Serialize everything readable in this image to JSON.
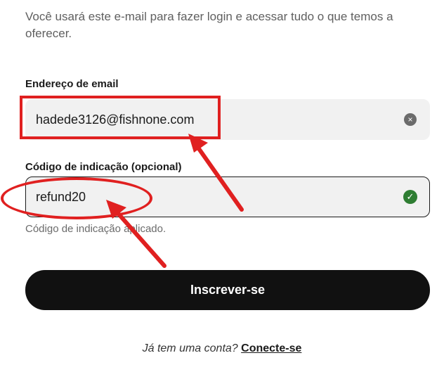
{
  "intro": {
    "text": "Você usará este e-mail para fazer login e acessar tudo o que temos a oferecer."
  },
  "email": {
    "label": "Endereço de email",
    "value": "hadede3126@fishnone.com",
    "clear_icon": "×"
  },
  "referral": {
    "label": "Código de indicação (opcional)",
    "value": "refund20",
    "status_icon": "✓",
    "helper": "Código de indicação aplicado."
  },
  "submit": {
    "label": "Inscrever-se"
  },
  "login": {
    "prompt": "Já tem uma conta?",
    "link": "Conecte-se"
  },
  "colors": {
    "annotation": "#e02020",
    "button": "#111111",
    "success": "#2e7d32",
    "field_bg": "#f1f1f1"
  },
  "icons": [
    "clear-icon",
    "check-icon"
  ]
}
